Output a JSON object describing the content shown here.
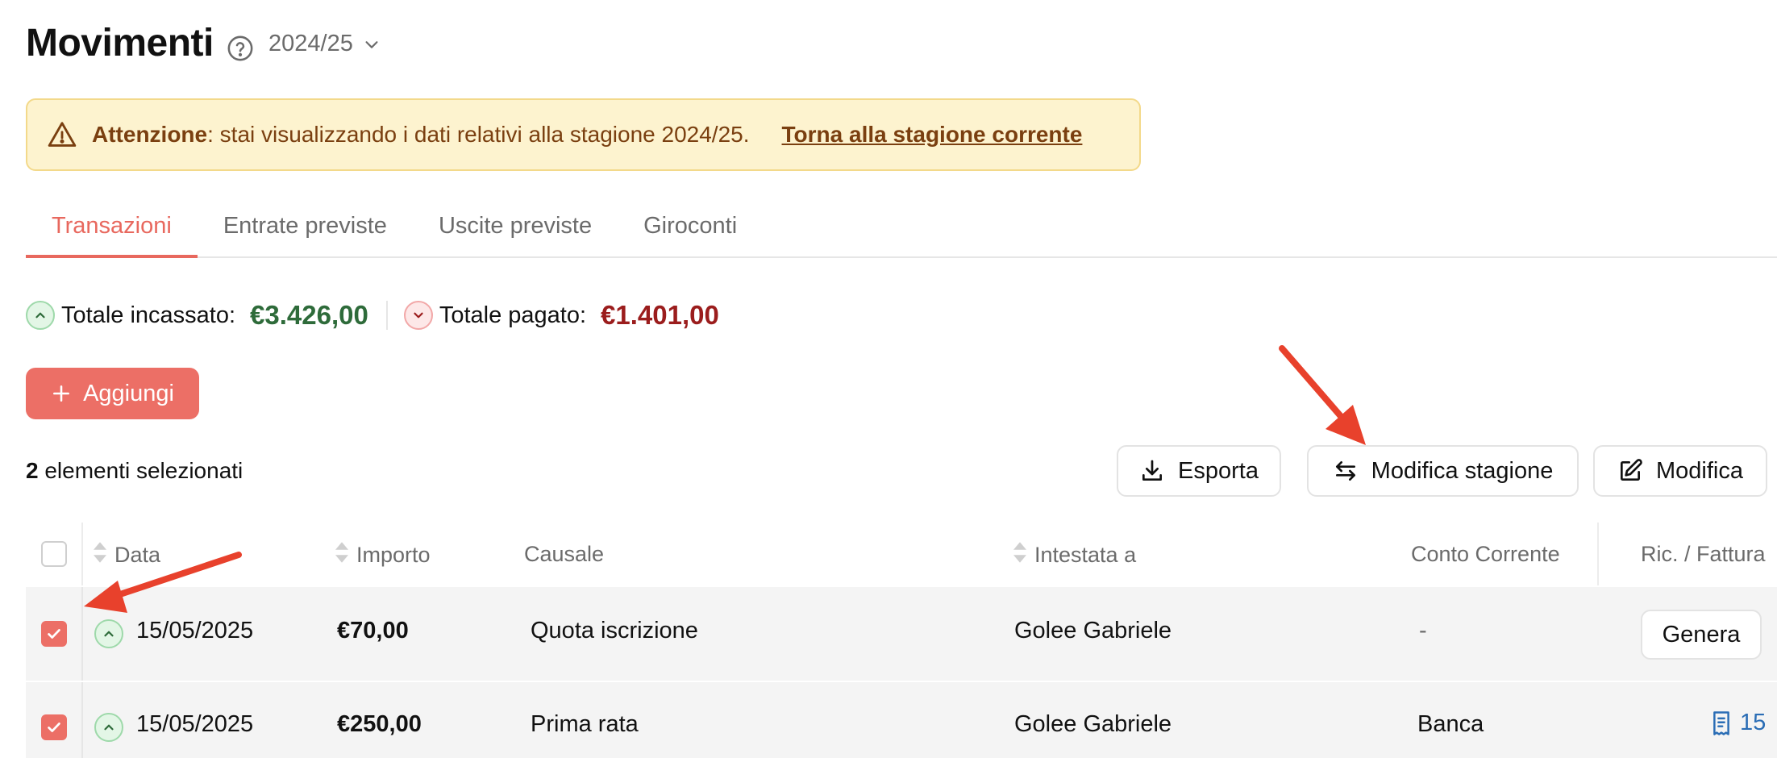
{
  "header": {
    "title": "Movimenti",
    "season": "2024/25",
    "icons": {
      "help": "help-icon",
      "season": "chevron-down-icon"
    }
  },
  "banner": {
    "label": "Attenzione",
    "message": ": stai visualizzando i dati relativi alla stagione 2024/25.",
    "link": "Torna alla stagione corrente",
    "icon": "warning-icon"
  },
  "tabs": [
    {
      "label": "Transazioni",
      "active": true
    },
    {
      "label": "Entrate previste",
      "active": false
    },
    {
      "label": "Uscite previste",
      "active": false
    },
    {
      "label": "Giroconti",
      "active": false
    }
  ],
  "totals": {
    "incassato_label": "Totale incassato:",
    "incassato_value": "€3.426,00",
    "pagato_label": "Totale pagato:",
    "pagato_value": "€1.401,00"
  },
  "add_button": {
    "label": "Aggiungi",
    "icon": "plus-icon"
  },
  "selection": {
    "count": "2",
    "text": "elementi selezionati"
  },
  "toolbar": {
    "export_label": "Esporta",
    "season_label": "Modifica stagione",
    "edit_label": "Modifica",
    "icons": {
      "export": "download-icon",
      "season": "swap-icon",
      "edit": "edit-icon"
    }
  },
  "table": {
    "columns": {
      "date": "Data",
      "amount": "Importo",
      "reason": "Causale",
      "holder": "Intestata a",
      "account": "Conto Corrente",
      "receipt": "Ric. / Fattura"
    },
    "rows": [
      {
        "selected": true,
        "direction": "in",
        "date": "15/05/2025",
        "amount": "€70,00",
        "reason": "Quota iscrizione",
        "holder": "Golee Gabriele",
        "account": "-",
        "receipt_action": "Genera"
      },
      {
        "selected": true,
        "direction": "in",
        "date": "15/05/2025",
        "amount": "€250,00",
        "reason": "Prima rata",
        "holder": "Golee Gabriele",
        "account": "Banca",
        "receipt_number": "15"
      }
    ]
  },
  "colors": {
    "accent": "#ec6f66",
    "tab_active": "#e8685e",
    "income": "#2e6b3a",
    "expense": "#9b1d1d",
    "banner_bg": "#fdf3cf",
    "banner_text": "#7a3f10",
    "link": "#2a6db5",
    "annotation_arrow": "#e8412c"
  }
}
